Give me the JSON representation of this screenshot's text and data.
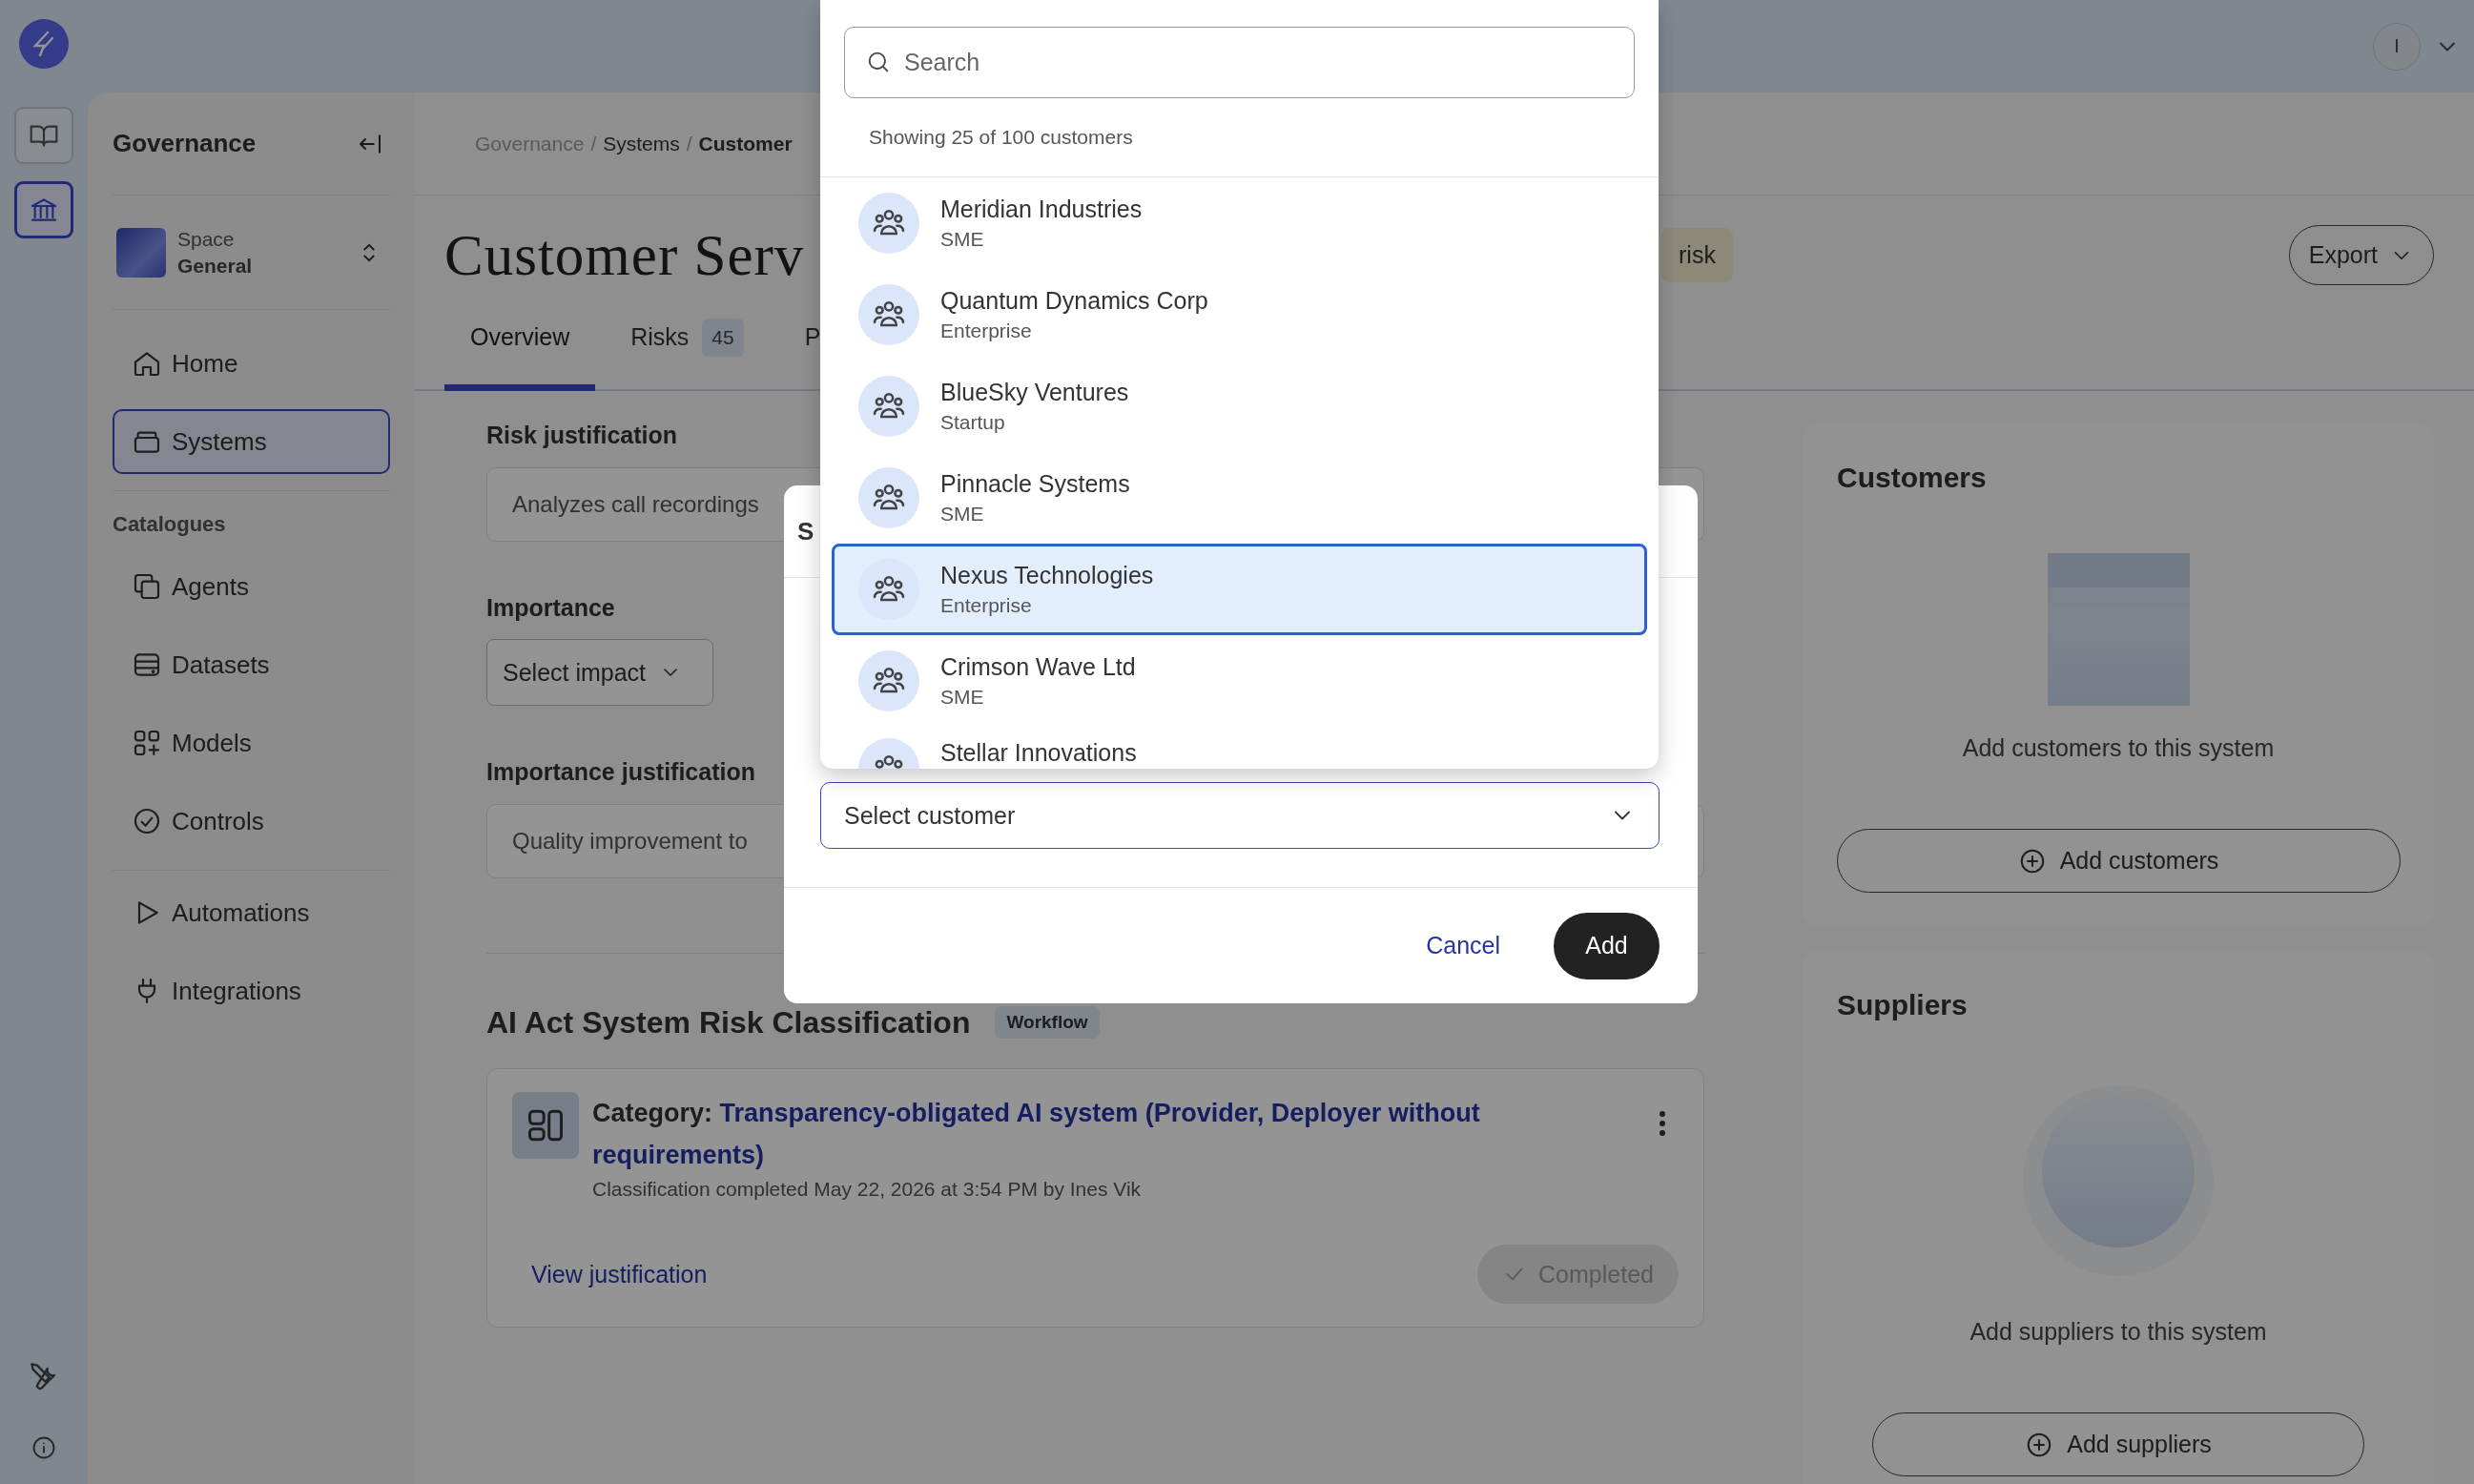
{
  "rail_items": [
    {
      "selected": false
    },
    {
      "selected": true
    }
  ],
  "top_bar": {
    "avatar": "I"
  },
  "sidebar": {
    "title": "Governance",
    "space": {
      "label": "Space",
      "name": "General"
    },
    "sections": [
      {
        "items": [
          {
            "label": "Home",
            "selected": false
          },
          {
            "label": "Systems",
            "selected": true
          }
        ]
      },
      {
        "heading": "Catalogues",
        "items": [
          {
            "label": "Agents",
            "selected": false
          },
          {
            "label": "Datasets",
            "selected": false
          },
          {
            "label": "Models",
            "selected": false
          },
          {
            "label": "Controls",
            "selected": false
          }
        ]
      },
      {
        "items": [
          {
            "label": "Automations",
            "selected": false
          },
          {
            "label": "Integrations",
            "selected": false
          }
        ]
      }
    ]
  },
  "breadcrumb": {
    "separator": "/",
    "items": [
      "Governance",
      "Systems",
      "Customer"
    ]
  },
  "page": {
    "title": "Customer Serv",
    "risk_badge": "risk",
    "export": "Export",
    "tabs": [
      {
        "label": "Overview",
        "selected": true
      },
      {
        "label": "Risks",
        "count": "45",
        "selected": false
      },
      {
        "label": "P",
        "selected": false
      }
    ]
  },
  "form": {
    "risk_justification": {
      "label": "Risk justification",
      "value": "Analyzes call recordings"
    },
    "importance": {
      "label": "Importance",
      "placeholder": "Select impact"
    },
    "importance_justification": {
      "label": "Importance justification",
      "value": "Quality improvement to"
    }
  },
  "classification": {
    "title": "AI Act System Risk Classification",
    "badge": "Workflow",
    "category_label": "Category:",
    "category": "Transparency-obligated AI system (Provider, Deployer without requirements)",
    "meta": "Classification completed May 22, 2026 at 3:54 PM by Ines Vik",
    "link": "View justification",
    "status": "Completed"
  },
  "customers_card": {
    "title": "Customers",
    "empty_text": "Add customers to this system",
    "button": "Add customers"
  },
  "suppliers_card": {
    "title": "Suppliers",
    "empty_text": "Add suppliers to this system",
    "button": "Add suppliers"
  },
  "modal": {
    "title": "S",
    "select_placeholder": "Select customer",
    "cancel": "Cancel",
    "confirm": "Add"
  },
  "customer_dropdown": {
    "search_placeholder": "Search",
    "summary": "Showing 25 of 100 customers",
    "options": [
      {
        "name": "Meridian Industries",
        "segment": "SME",
        "selected": false
      },
      {
        "name": "Quantum Dynamics Corp",
        "segment": "Enterprise",
        "selected": false
      },
      {
        "name": "BlueSky Ventures",
        "segment": "Startup",
        "selected": false
      },
      {
        "name": "Pinnacle Systems",
        "segment": "SME",
        "selected": false
      },
      {
        "name": "Nexus Technologies",
        "segment": "Enterprise",
        "selected": true
      },
      {
        "name": "Crimson Wave Ltd",
        "segment": "SME",
        "selected": false
      },
      {
        "name": "Stellar Innovations",
        "selected": false
      }
    ]
  }
}
